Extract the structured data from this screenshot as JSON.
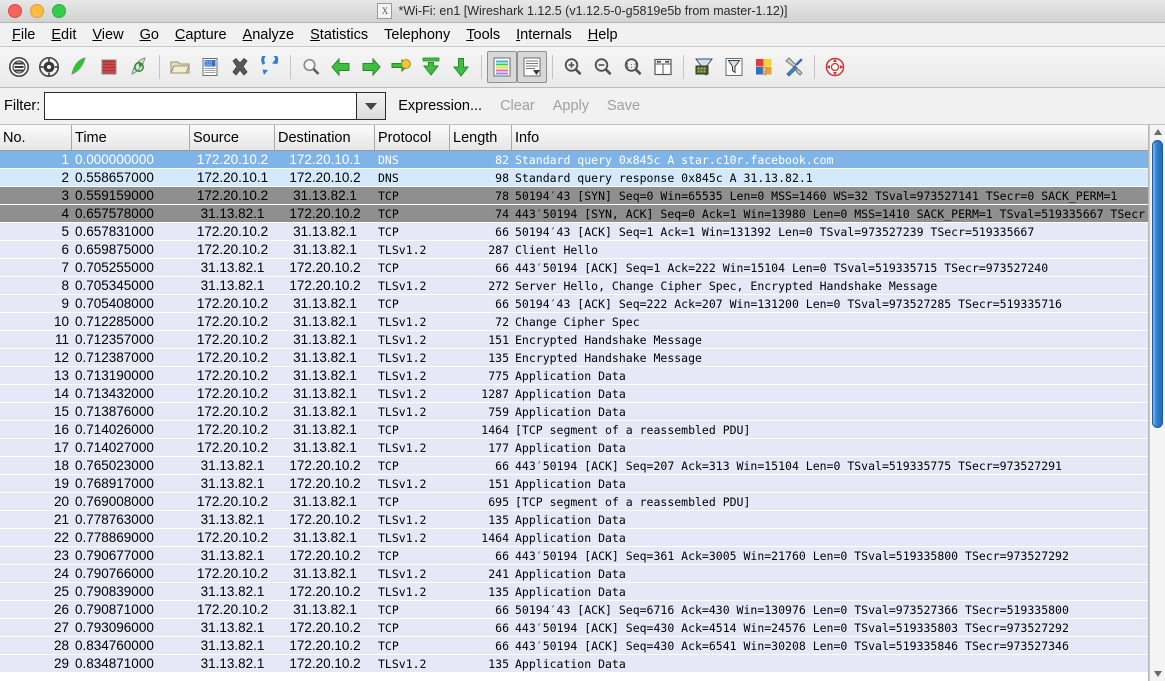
{
  "window": {
    "title": "*Wi-Fi: en1   [Wireshark 1.12.5  (v1.12.5-0-g5819e5b from master-1.12)]",
    "app_icon": "x-window-icon",
    "controls": {
      "close": "close-button",
      "minimize": "minimize-button",
      "maximize": "maximize-button"
    }
  },
  "menu": [
    {
      "label": "File",
      "mnemonic": "F"
    },
    {
      "label": "Edit",
      "mnemonic": "E"
    },
    {
      "label": "View",
      "mnemonic": "V"
    },
    {
      "label": "Go",
      "mnemonic": "G"
    },
    {
      "label": "Capture",
      "mnemonic": "C"
    },
    {
      "label": "Analyze",
      "mnemonic": "A"
    },
    {
      "label": "Statistics",
      "mnemonic": "S"
    },
    {
      "label": "Telephony",
      "mnemonic": ""
    },
    {
      "label": "Tools",
      "mnemonic": "T"
    },
    {
      "label": "Internals",
      "mnemonic": "I"
    },
    {
      "label": "Help",
      "mnemonic": "H"
    }
  ],
  "toolbar": [
    {
      "name": "interface-list-icon",
      "kind": "icon"
    },
    {
      "name": "capture-options-icon",
      "kind": "icon"
    },
    {
      "name": "start-capture-icon",
      "kind": "icon"
    },
    {
      "name": "stop-capture-icon",
      "kind": "icon"
    },
    {
      "name": "restart-capture-icon",
      "kind": "icon"
    },
    {
      "name": "separator",
      "kind": "sep"
    },
    {
      "name": "open-file-icon",
      "kind": "icon"
    },
    {
      "name": "save-file-icon",
      "kind": "icon"
    },
    {
      "name": "close-file-icon",
      "kind": "icon"
    },
    {
      "name": "reload-icon",
      "kind": "icon"
    },
    {
      "name": "separator",
      "kind": "sep"
    },
    {
      "name": "find-packet-icon",
      "kind": "icon"
    },
    {
      "name": "go-back-icon",
      "kind": "icon"
    },
    {
      "name": "go-forward-icon",
      "kind": "icon"
    },
    {
      "name": "go-to-packet-icon",
      "kind": "icon"
    },
    {
      "name": "go-to-first-packet-icon",
      "kind": "icon"
    },
    {
      "name": "go-to-last-packet-icon",
      "kind": "icon"
    },
    {
      "name": "separator",
      "kind": "sep"
    },
    {
      "name": "colorize-packet-list-icon",
      "kind": "icon-pressed"
    },
    {
      "name": "auto-scroll-live-capture-icon",
      "kind": "icon-pressed"
    },
    {
      "name": "separator",
      "kind": "sep"
    },
    {
      "name": "zoom-in-icon",
      "kind": "icon"
    },
    {
      "name": "zoom-out-icon",
      "kind": "icon"
    },
    {
      "name": "zoom-reset-icon",
      "kind": "icon"
    },
    {
      "name": "resize-columns-icon",
      "kind": "icon"
    },
    {
      "name": "separator",
      "kind": "sep"
    },
    {
      "name": "capture-filters-icon",
      "kind": "icon"
    },
    {
      "name": "display-filters-icon",
      "kind": "icon"
    },
    {
      "name": "coloring-rules-icon",
      "kind": "icon"
    },
    {
      "name": "preferences-icon",
      "kind": "icon"
    },
    {
      "name": "separator",
      "kind": "sep"
    },
    {
      "name": "help-contents-icon",
      "kind": "icon"
    }
  ],
  "filter_bar": {
    "label": "Filter:",
    "value": "",
    "placeholder": "",
    "dropdown_icon": "chevron-down-icon",
    "expression_label": "Expression...",
    "clear_label": "Clear",
    "apply_label": "Apply",
    "save_label": "Save",
    "clear_enabled": false,
    "apply_enabled": false,
    "save_enabled": false
  },
  "packet_list": {
    "columns": [
      {
        "key": "no",
        "label": "No."
      },
      {
        "key": "time",
        "label": "Time"
      },
      {
        "key": "src",
        "label": "Source"
      },
      {
        "key": "dst",
        "label": "Destination"
      },
      {
        "key": "proto",
        "label": "Protocol"
      },
      {
        "key": "len",
        "label": "Length"
      },
      {
        "key": "info",
        "label": "Info"
      }
    ],
    "selected_row": 1,
    "colors": {
      "selected_bg": "#7fb4e8",
      "selected_fg": "#ffffff",
      "dns_bg": "#d4eafc",
      "tcp_syn_bg": "#8f8f8f",
      "normal_bg": "#e7e7f7",
      "scrollbar_thumb": "#2f7fd1"
    },
    "rows": [
      {
        "no": "1",
        "time": "0.000000000",
        "src": "172.20.10.2",
        "dst": "172.20.10.1",
        "proto": "DNS",
        "len": "82",
        "info": "Standard query 0x845c  A star.c10r.facebook.com",
        "style": "st-selected"
      },
      {
        "no": "2",
        "time": "0.558657000",
        "src": "172.20.10.1",
        "dst": "172.20.10.2",
        "proto": "DNS",
        "len": "98",
        "info": "Standard query response 0x845c  A 31.13.82.1",
        "style": "st-dns"
      },
      {
        "no": "3",
        "time": "0.559159000",
        "src": "172.20.10.2",
        "dst": "31.13.82.1",
        "proto": "TCP",
        "len": "78",
        "info": "50194′43 [SYN] Seq=0 Win=65535 Len=0 MSS=1460 WS=32 TSval=973527141 TSecr=0 SACK_PERM=1",
        "style": "st-tcp-syn"
      },
      {
        "no": "4",
        "time": "0.657578000",
        "src": "31.13.82.1",
        "dst": "172.20.10.2",
        "proto": "TCP",
        "len": "74",
        "info": "443′50194 [SYN, ACK] Seq=0 Ack=1 Win=13980 Len=0 MSS=1410 SACK_PERM=1 TSval=519335667 TSecr",
        "style": "st-tcp-syn"
      },
      {
        "no": "5",
        "time": "0.657831000",
        "src": "172.20.10.2",
        "dst": "31.13.82.1",
        "proto": "TCP",
        "len": "66",
        "info": "50194′43 [ACK] Seq=1 Ack=1 Win=131392 Len=0 TSval=973527239 TSecr=519335667",
        "style": "st-normal"
      },
      {
        "no": "6",
        "time": "0.659875000",
        "src": "172.20.10.2",
        "dst": "31.13.82.1",
        "proto": "TLSv1.2",
        "len": "287",
        "info": "Client Hello",
        "style": "st-normal"
      },
      {
        "no": "7",
        "time": "0.705255000",
        "src": "31.13.82.1",
        "dst": "172.20.10.2",
        "proto": "TCP",
        "len": "66",
        "info": "443′50194 [ACK] Seq=1 Ack=222 Win=15104 Len=0 TSval=519335715 TSecr=973527240",
        "style": "st-normal"
      },
      {
        "no": "8",
        "time": "0.705345000",
        "src": "31.13.82.1",
        "dst": "172.20.10.2",
        "proto": "TLSv1.2",
        "len": "272",
        "info": "Server Hello, Change Cipher Spec, Encrypted Handshake Message",
        "style": "st-normal"
      },
      {
        "no": "9",
        "time": "0.705408000",
        "src": "172.20.10.2",
        "dst": "31.13.82.1",
        "proto": "TCP",
        "len": "66",
        "info": "50194′43 [ACK] Seq=222 Ack=207 Win=131200 Len=0 TSval=973527285 TSecr=519335716",
        "style": "st-normal"
      },
      {
        "no": "10",
        "time": "0.712285000",
        "src": "172.20.10.2",
        "dst": "31.13.82.1",
        "proto": "TLSv1.2",
        "len": "72",
        "info": "Change Cipher Spec",
        "style": "st-normal"
      },
      {
        "no": "11",
        "time": "0.712357000",
        "src": "172.20.10.2",
        "dst": "31.13.82.1",
        "proto": "TLSv1.2",
        "len": "151",
        "info": "Encrypted Handshake Message",
        "style": "st-normal"
      },
      {
        "no": "12",
        "time": "0.712387000",
        "src": "172.20.10.2",
        "dst": "31.13.82.1",
        "proto": "TLSv1.2",
        "len": "135",
        "info": "Encrypted Handshake Message",
        "style": "st-normal"
      },
      {
        "no": "13",
        "time": "0.713190000",
        "src": "172.20.10.2",
        "dst": "31.13.82.1",
        "proto": "TLSv1.2",
        "len": "775",
        "info": "Application Data",
        "style": "st-normal"
      },
      {
        "no": "14",
        "time": "0.713432000",
        "src": "172.20.10.2",
        "dst": "31.13.82.1",
        "proto": "TLSv1.2",
        "len": "1287",
        "info": "Application Data",
        "style": "st-normal"
      },
      {
        "no": "15",
        "time": "0.713876000",
        "src": "172.20.10.2",
        "dst": "31.13.82.1",
        "proto": "TLSv1.2",
        "len": "759",
        "info": "Application Data",
        "style": "st-normal"
      },
      {
        "no": "16",
        "time": "0.714026000",
        "src": "172.20.10.2",
        "dst": "31.13.82.1",
        "proto": "TCP",
        "len": "1464",
        "info": "[TCP segment of a reassembled PDU]",
        "style": "st-normal"
      },
      {
        "no": "17",
        "time": "0.714027000",
        "src": "172.20.10.2",
        "dst": "31.13.82.1",
        "proto": "TLSv1.2",
        "len": "177",
        "info": "Application Data",
        "style": "st-normal"
      },
      {
        "no": "18",
        "time": "0.765023000",
        "src": "31.13.82.1",
        "dst": "172.20.10.2",
        "proto": "TCP",
        "len": "66",
        "info": "443′50194 [ACK] Seq=207 Ack=313 Win=15104 Len=0 TSval=519335775 TSecr=973527291",
        "style": "st-normal"
      },
      {
        "no": "19",
        "time": "0.768917000",
        "src": "31.13.82.1",
        "dst": "172.20.10.2",
        "proto": "TLSv1.2",
        "len": "151",
        "info": "Application Data",
        "style": "st-normal"
      },
      {
        "no": "20",
        "time": "0.769008000",
        "src": "172.20.10.2",
        "dst": "31.13.82.1",
        "proto": "TCP",
        "len": "695",
        "info": "[TCP segment of a reassembled PDU]",
        "style": "st-normal"
      },
      {
        "no": "21",
        "time": "0.778763000",
        "src": "31.13.82.1",
        "dst": "172.20.10.2",
        "proto": "TLSv1.2",
        "len": "135",
        "info": "Application Data",
        "style": "st-normal"
      },
      {
        "no": "22",
        "time": "0.778869000",
        "src": "172.20.10.2",
        "dst": "31.13.82.1",
        "proto": "TLSv1.2",
        "len": "1464",
        "info": "Application Data",
        "style": "st-normal"
      },
      {
        "no": "23",
        "time": "0.790677000",
        "src": "31.13.82.1",
        "dst": "172.20.10.2",
        "proto": "TCP",
        "len": "66",
        "info": "443′50194 [ACK] Seq=361 Ack=3005 Win=21760 Len=0 TSval=519335800 TSecr=973527292",
        "style": "st-normal"
      },
      {
        "no": "24",
        "time": "0.790766000",
        "src": "172.20.10.2",
        "dst": "31.13.82.1",
        "proto": "TLSv1.2",
        "len": "241",
        "info": "Application Data",
        "style": "st-normal"
      },
      {
        "no": "25",
        "time": "0.790839000",
        "src": "31.13.82.1",
        "dst": "172.20.10.2",
        "proto": "TLSv1.2",
        "len": "135",
        "info": "Application Data",
        "style": "st-normal"
      },
      {
        "no": "26",
        "time": "0.790871000",
        "src": "172.20.10.2",
        "dst": "31.13.82.1",
        "proto": "TCP",
        "len": "66",
        "info": "50194′43 [ACK] Seq=6716 Ack=430 Win=130976 Len=0 TSval=973527366 TSecr=519335800",
        "style": "st-normal"
      },
      {
        "no": "27",
        "time": "0.793096000",
        "src": "31.13.82.1",
        "dst": "172.20.10.2",
        "proto": "TCP",
        "len": "66",
        "info": "443′50194 [ACK] Seq=430 Ack=4514 Win=24576 Len=0 TSval=519335803 TSecr=973527292",
        "style": "st-normal"
      },
      {
        "no": "28",
        "time": "0.834760000",
        "src": "31.13.82.1",
        "dst": "172.20.10.2",
        "proto": "TCP",
        "len": "66",
        "info": "443′50194 [ACK] Seq=430 Ack=6541 Win=30208 Len=0 TSval=519335846 TSecr=973527346",
        "style": "st-normal"
      },
      {
        "no": "29",
        "time": "0.834871000",
        "src": "31.13.82.1",
        "dst": "172.20.10.2",
        "proto": "TLSv1.2",
        "len": "135",
        "info": "Application Data",
        "style": "st-normal"
      }
    ]
  },
  "scrollbar": {
    "up_arrow_icon": "scroll-up-arrow-icon",
    "down_arrow_icon": "scroll-down-arrow-icon",
    "thumb_name": "vertical-scrollbar-thumb"
  }
}
